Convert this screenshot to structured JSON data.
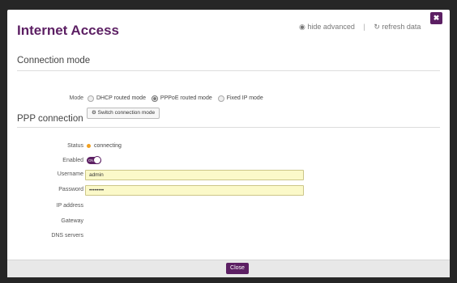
{
  "dialog": {
    "title": "Internet Access",
    "close_icon_glyph": "✖",
    "header_actions": {
      "hide_advanced_icon": "eye-icon",
      "hide_advanced_label": "hide advanced",
      "separator": "|",
      "refresh_icon": "refresh-icon",
      "refresh_label": "refresh data"
    }
  },
  "connection_mode": {
    "section_title": "Connection mode",
    "mode_label": "Mode",
    "options": [
      {
        "label": "DHCP routed mode",
        "selected": false
      },
      {
        "label": "PPPoE routed mode",
        "selected": true
      },
      {
        "label": "Fixed IP mode",
        "selected": false
      }
    ],
    "switch_button_icon": "gear-icon",
    "switch_button_label": "Switch connection mode"
  },
  "ppp": {
    "section_title": "PPP connection",
    "status_label": "Status",
    "status_value": "connecting",
    "status_color": "#f0a020",
    "enabled_label": "Enabled",
    "enabled_toggle_text": "ON",
    "enabled": true,
    "username_label": "Username",
    "username_value": "admin",
    "password_label": "Password",
    "password_value": "••••••••",
    "ip_address_label": "IP address",
    "gateway_label": "Gateway",
    "dns_label": "DNS servers"
  },
  "footer": {
    "close_label": "Close"
  },
  "colors": {
    "accent": "#5c1f63",
    "input_bg": "#fbf9c9"
  }
}
